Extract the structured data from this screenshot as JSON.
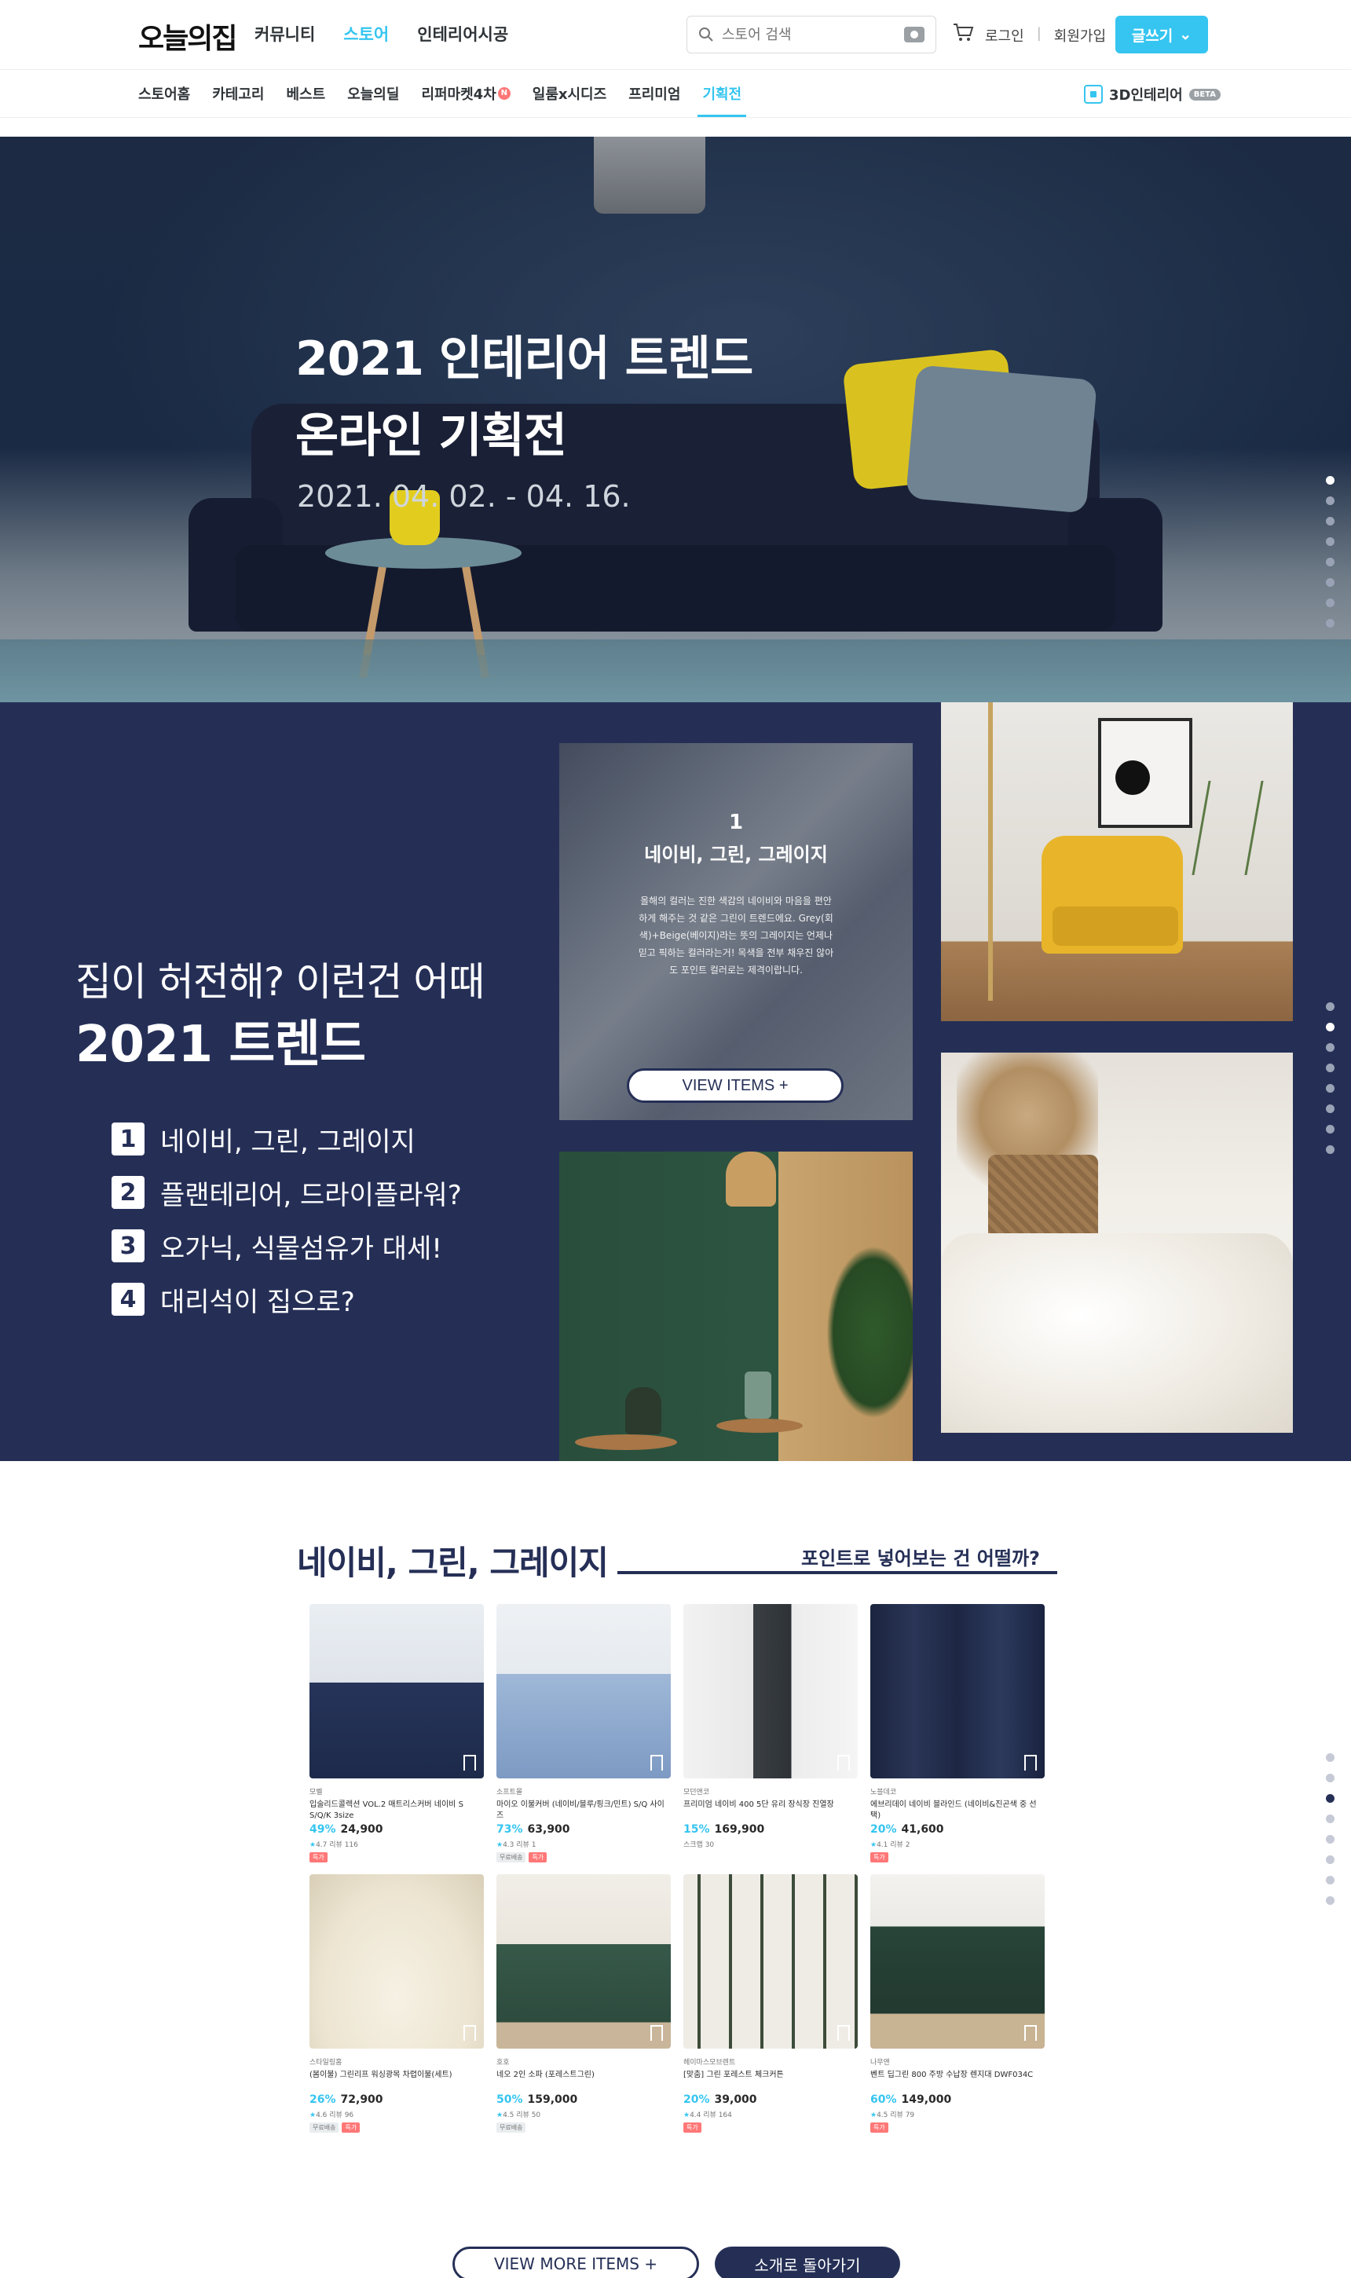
{
  "header": {
    "logo": "오늘의집",
    "nav": [
      "커뮤니티",
      "스토어",
      "인테리어시공"
    ],
    "active_nav": "스토어",
    "search_placeholder": "스토어 검색",
    "login": "로그인",
    "signup": "회원가입",
    "write_button": "글쓰기",
    "sub_nav": [
      "스토어홈",
      "카테고리",
      "베스트",
      "오늘의딜",
      "리퍼마켓4차",
      "일룸x시디즈",
      "프리미엄",
      "기획전"
    ],
    "sub_nav_badge": "N",
    "active_sub_nav": "기획전",
    "link_3d": "3D인테리어",
    "beta": "BETA"
  },
  "hero": {
    "title": "2021 인테리어 트렌드\n온라인 기획전",
    "date": "2021. 04. 02. - 04. 16.",
    "dots_count": 8,
    "active_dot": 0
  },
  "trend": {
    "subtitle": "집이 허전해? 이런건 어때",
    "title": "2021 트렌드",
    "items": [
      {
        "num": "1",
        "label": "네이비, 그린, 그레이지"
      },
      {
        "num": "2",
        "label": "플랜테리어, 드라이플라워?"
      },
      {
        "num": "3",
        "label": "오가닉, 식물섬유가 대세!"
      },
      {
        "num": "4",
        "label": "대리석이 집으로?"
      }
    ],
    "card": {
      "num": "1",
      "title": "네이비, 그린, 그레이지",
      "desc": "올해의 컬러는 진한 색감의 네이비와 마음을 편안하게 해주는 것 같은 그린이 트렌드에요. Grey(회색)+Beige(베이지)라는 뜻의 그레이지는 언제나 믿고 픽하는 컬러라는거! 목색을 전부 채우진 않아도 포인트 컬러로는 제격이랍니다.",
      "button": "VIEW ITEMS +"
    },
    "dots_count": 8,
    "active_dot": 1
  },
  "products": {
    "heading": "네이비, 그린, 그레이지",
    "heading_right": "포인트로 넣어보는 건 어떨까?",
    "items": [
      {
        "brand": "모벨",
        "name": "입술리드콜렉션 VOL.2 매트리스커버 네이비 S S/Q/K 3size",
        "discount": "49%",
        "price": "24,900",
        "rating": "4.7",
        "reviews": "리뷰 116",
        "tags": [
          "특가"
        ]
      },
      {
        "brand": "소프트몰",
        "name": "마이오 이불커버 (네이비/블루/핑크/민트) S/Q 사이즈",
        "discount": "73%",
        "price": "63,900",
        "rating": "4.3",
        "reviews": "리뷰 1",
        "tags": [
          "무료배송",
          "특가"
        ]
      },
      {
        "brand": "모던앤코",
        "name": "프리미엄 네이비 400 5단 유리 장식장 진열장",
        "discount": "15%",
        "price": "169,900",
        "rating": "",
        "reviews": "스크랩 30",
        "tags": []
      },
      {
        "brand": "노블데코",
        "name": "에브리데이 네이비 블라인드 (네이비&진곤색 중 선택)",
        "discount": "20%",
        "price": "41,600",
        "rating": "4.1",
        "reviews": "리뷰 2",
        "tags": [
          "특가"
        ]
      },
      {
        "brand": "스타일링홈",
        "name": "(봄이불) 그린리프 워싱광목 차렵이불(세트)",
        "discount": "26%",
        "price": "72,900",
        "rating": "4.6",
        "reviews": "리뷰 96",
        "tags": [
          "무료배송",
          "특가"
        ]
      },
      {
        "brand": "호호",
        "name": "네오 2인 소파 (포레스트그린)",
        "discount": "50%",
        "price": "159,000",
        "rating": "4.5",
        "reviews": "리뷰 50",
        "tags": [
          "무료배송"
        ]
      },
      {
        "brand": "헤이마스모브렌트",
        "name": "[맞춤] 그린 포레스트 체크커튼",
        "discount": "20%",
        "price": "39,000",
        "rating": "4.4",
        "reviews": "리뷰 164",
        "tags": [
          "특가"
        ]
      },
      {
        "brand": "나무앤",
        "name": "벤트 딥그린 800 주방 수납장 렌지대 DWF034C",
        "discount": "60%",
        "price": "149,000",
        "rating": "4.5",
        "reviews": "리뷰 79",
        "tags": [
          "특가"
        ]
      }
    ],
    "view_more": "VIEW MORE ITEMS +",
    "back_button": "소개로 돌아가기",
    "dots_count": 8,
    "active_dot": 2
  },
  "colors": {
    "accent": "#35c5f0",
    "navy": "#252f56",
    "special_tag": "#ff7777"
  },
  "icons": [
    "search-icon",
    "camera-icon",
    "cart-icon",
    "chevron-down-icon",
    "cube-icon",
    "bookmark-icon",
    "star-icon"
  ]
}
